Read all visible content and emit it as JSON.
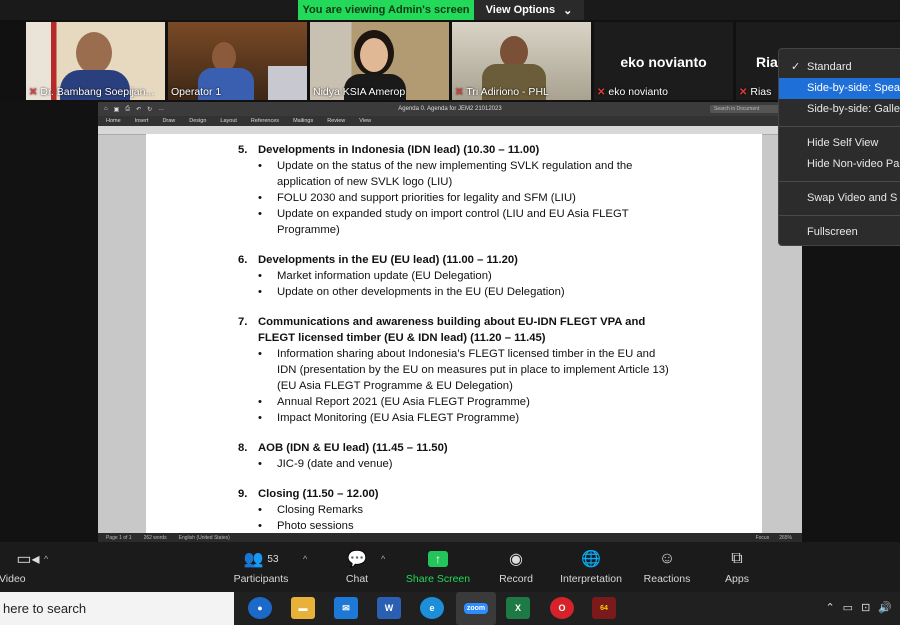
{
  "banner": {
    "viewing": "You are viewing Admin's screen",
    "view_options": "View Options"
  },
  "participants": [
    {
      "name": "Dr. Bambang Soepijan..."
    },
    {
      "name": "Operator 1"
    },
    {
      "name": "Nidya KSIA Amerop"
    },
    {
      "name": "Tri Adiriono - PHL"
    },
    {
      "name": "eko novianto",
      "bigname": "eko novianto"
    },
    {
      "name": "Rias",
      "bigname": "Ria"
    }
  ],
  "word": {
    "doc_title": "Agenda 0. Agenda for JEM2 21012023",
    "search_placeholder": "Search in Document",
    "ribbon_tabs": [
      "Home",
      "Insert",
      "Draw",
      "Design",
      "Layout",
      "References",
      "Mailings",
      "Review",
      "View"
    ],
    "status": {
      "page": "Page 1 of 1",
      "words": "262 words",
      "lang": "English (United States)",
      "focus": "Focus",
      "zoom": "265%"
    }
  },
  "agenda": [
    {
      "num": "5.",
      "title": "Developments in Indonesia (IDN lead) (10.30 – 11.00)",
      "items": [
        "Update on the status of the new implementing SVLK regulation and the application of new SVLK logo (LIU)",
        "FOLU 2030 and support priorities for legality and SFM (LIU)",
        "Update on expanded study on import control (LIU and EU Asia FLEGT Programme)"
      ]
    },
    {
      "num": "6.",
      "title": "Developments in the EU (EU lead) (11.00 – 11.20)",
      "items": [
        "Market information update (EU Delegation)",
        "Update on other developments in the EU (EU Delegation)"
      ]
    },
    {
      "num": "7.",
      "title": "Communications and awareness building about EU-IDN FLEGT VPA and FLEGT licensed timber (EU & IDN lead) (11.20 – 11.45)",
      "items": [
        "Information sharing about Indonesia’s FLEGT licensed timber in the EU and IDN (presentation by the EU on measures put in place to implement Article 13) (EU Asia FLEGT Programme & EU Delegation)",
        "Annual Report 2021 (EU Asia FLEGT Programme)",
        "Impact Monitoring (EU Asia FLEGT Programme)"
      ]
    },
    {
      "num": "8.",
      "title": "AOB (IDN & EU lead) (11.45 – 11.50)",
      "items": [
        "JIC-9 (date and venue)"
      ]
    },
    {
      "num": "9.",
      "title": "Closing (11.50 – 12.00)",
      "items": [
        "Closing Remarks",
        "Photo sessions"
      ]
    }
  ],
  "view_menu": {
    "items": [
      "Standard",
      "Side-by-side: Spea",
      "Side-by-side: Galle",
      "Hide Self View",
      "Hide Non-video Pa",
      "Swap Video and S",
      "Fullscreen"
    ],
    "checked": "Standard",
    "highlighted": "Side-by-side: Spea"
  },
  "toolbar": {
    "video": "op Video",
    "participants": "Participants",
    "participant_count": "53",
    "chat": "Chat",
    "share": "Share Screen",
    "record": "Record",
    "interpretation": "Interpretation",
    "reactions": "Reactions",
    "apps": "Apps"
  },
  "taskbar": {
    "search": "here to search",
    "zoom_app": "zoom",
    "badge": "64"
  },
  "colors": {
    "share_green": "#23d959",
    "menu_highlight": "#1f6fd8",
    "mic_muted": "#e43a3a"
  }
}
